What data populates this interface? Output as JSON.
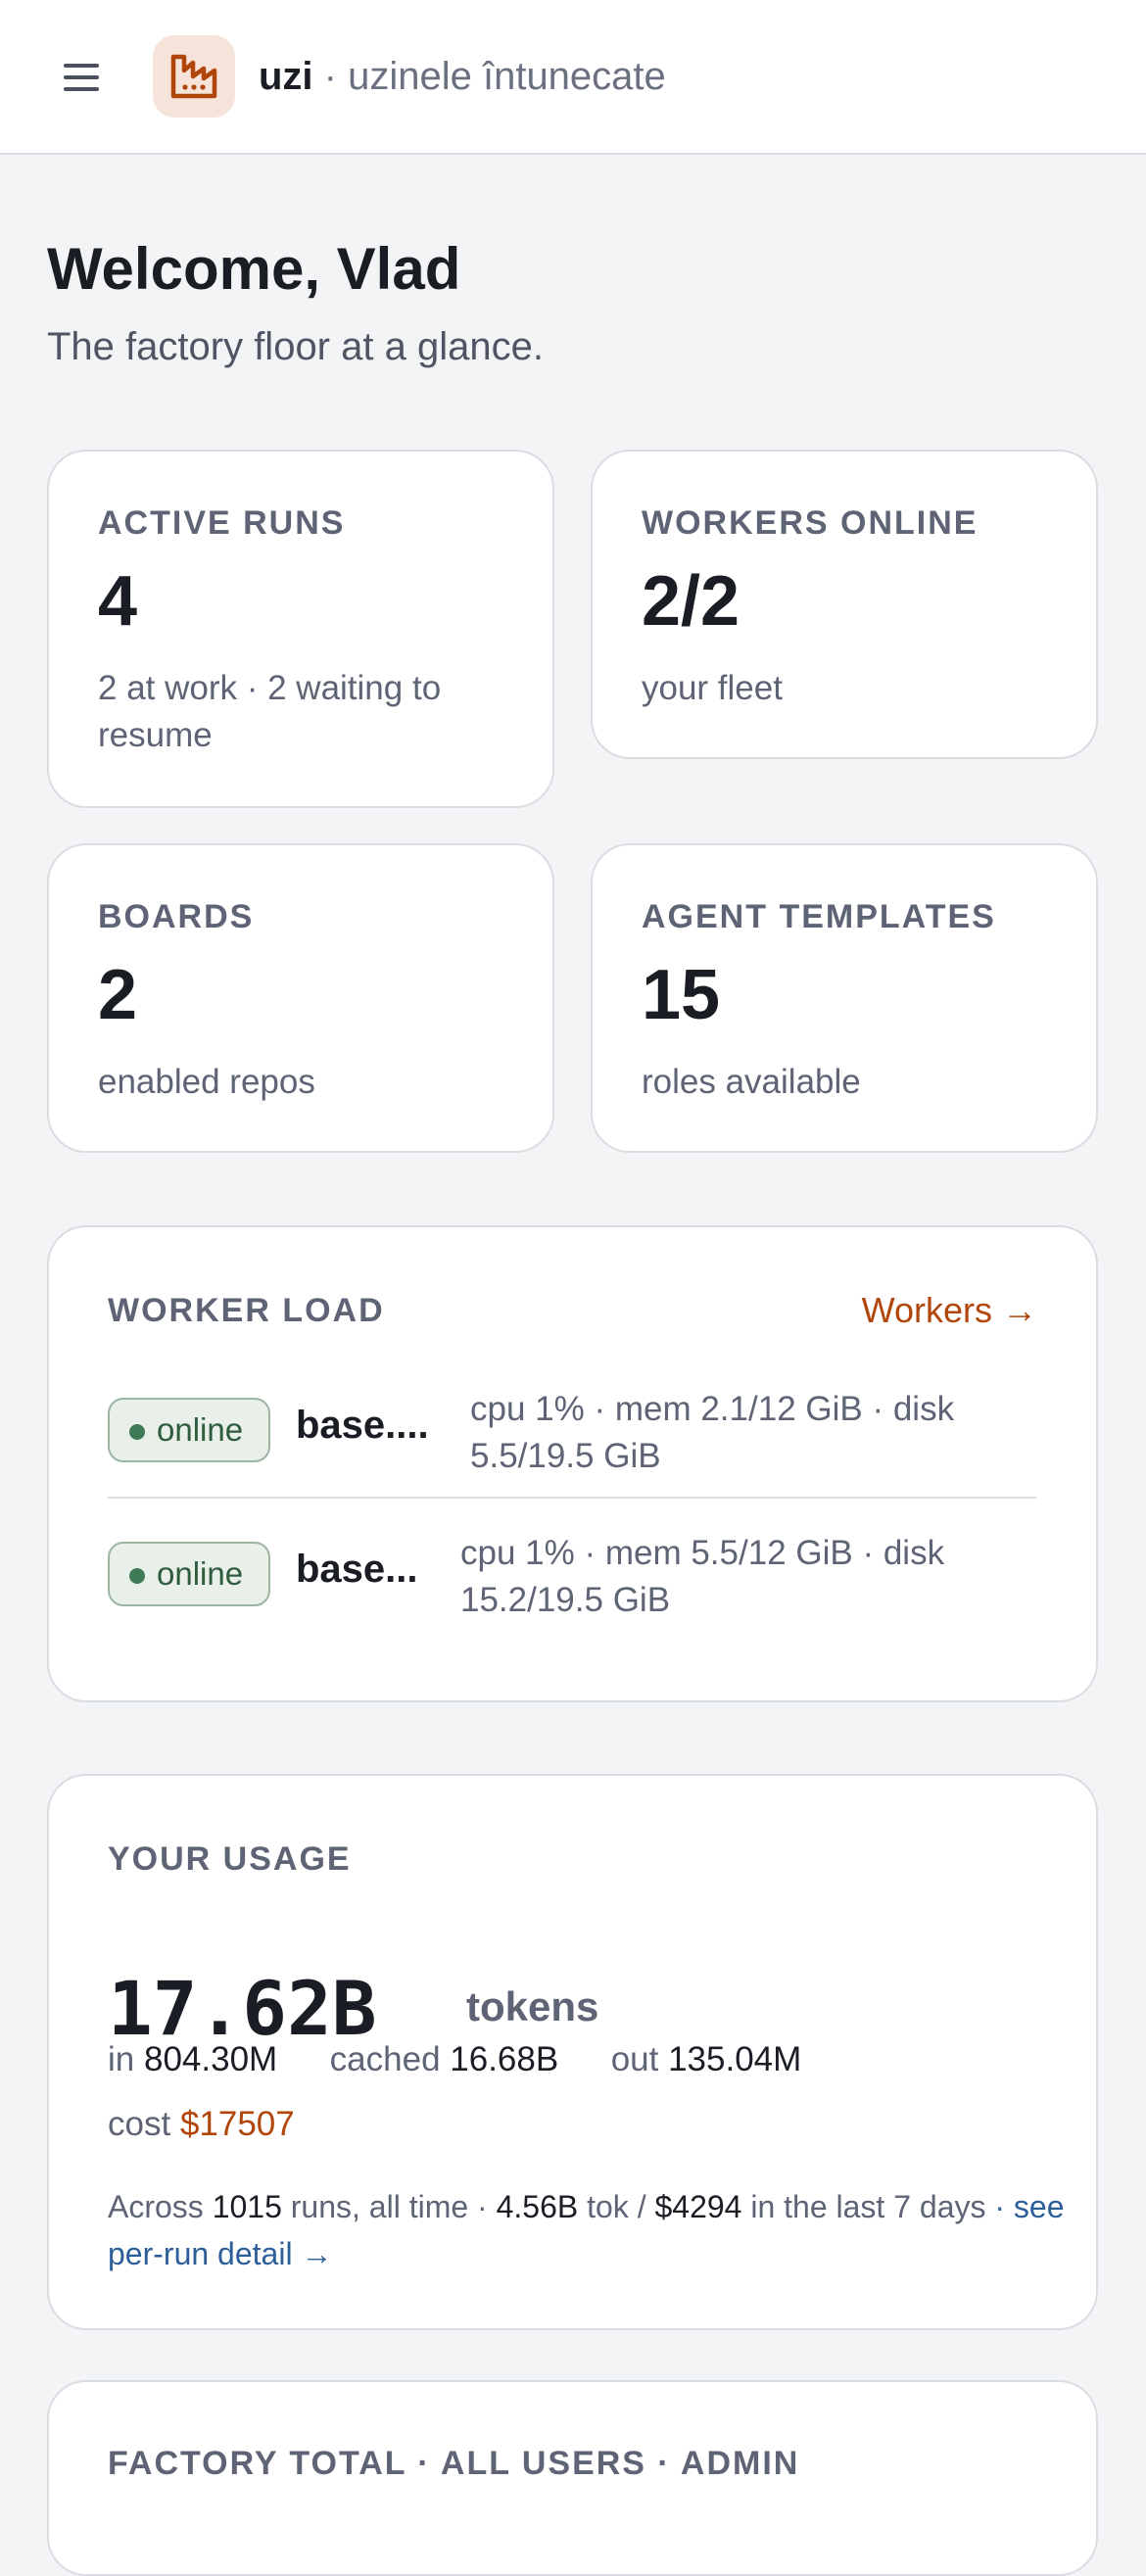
{
  "header": {
    "brand_name": "uzi",
    "brand_sep": " · ",
    "brand_sub": "uzinele întunecate"
  },
  "welcome": {
    "title": "Welcome, Vlad",
    "tagline": "The factory floor at a glance."
  },
  "stats": [
    {
      "label": "ACTIVE RUNS",
      "value": "4",
      "sub": "2 at work · 2 waiting to resume"
    },
    {
      "label": "WORKERS ONLINE",
      "value": "2/2",
      "sub": "your fleet"
    },
    {
      "label": "BOARDS",
      "value": "2",
      "sub": "enabled repos"
    },
    {
      "label": "AGENT TEMPLATES",
      "value": "15",
      "sub": "roles available"
    }
  ],
  "worker_load": {
    "label": "WORKER LOAD",
    "link": "Workers →",
    "workers": [
      {
        "status": "online",
        "name": "base....",
        "stats": "cpu 1% · mem 2.1/12 GiB · disk 5.5/19.5 GiB"
      },
      {
        "status": "online",
        "name": "base...",
        "stats": "cpu 1% · mem 5.5/12 GiB · disk 15.2/19.5 GiB"
      }
    ]
  },
  "usage": {
    "label": "YOUR USAGE",
    "total": "17.62B",
    "unit": "tokens",
    "in_label": "in",
    "in_value": "804.30M",
    "cached_label": "cached",
    "cached_value": "16.68B",
    "out_label": "out",
    "out_value": "135.04M",
    "cost_label": "cost",
    "cost_value": "$17507",
    "foot_prefix": "Across",
    "foot_runs": "1015",
    "foot_mid": "runs, all time · ",
    "foot_recent": "4.56B",
    "foot_tok": "tok / ",
    "foot_cost": "$4294",
    "foot_suffix": "in the last 7 days",
    "foot_link": "· see per-run detail →"
  },
  "factory_total": {
    "label": "FACTORY TOTAL · ALL USERS · ADMIN"
  },
  "colors": {
    "accent": "#b1460b",
    "link": "#2c5f9a",
    "online": "#3e7a55"
  }
}
